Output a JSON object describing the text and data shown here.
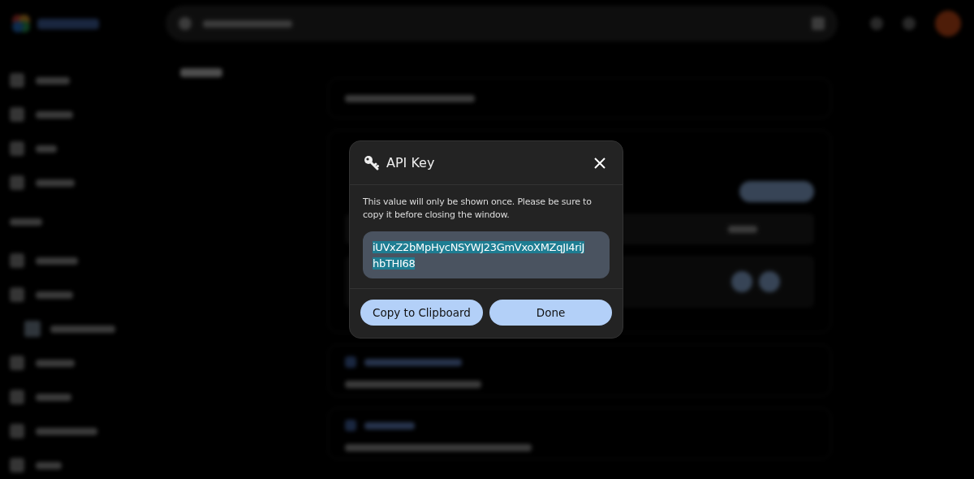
{
  "dialog": {
    "title": "API Key",
    "message": "This value will only be shown once. Please be sure to copy it before closing the window.",
    "key_value": "iUVxZ2bMpHycNSYWJ23GmVxoXMZqJI4riJhbTHI68",
    "buttons": [
      "Copy to Clipboard",
      "Done"
    ]
  }
}
